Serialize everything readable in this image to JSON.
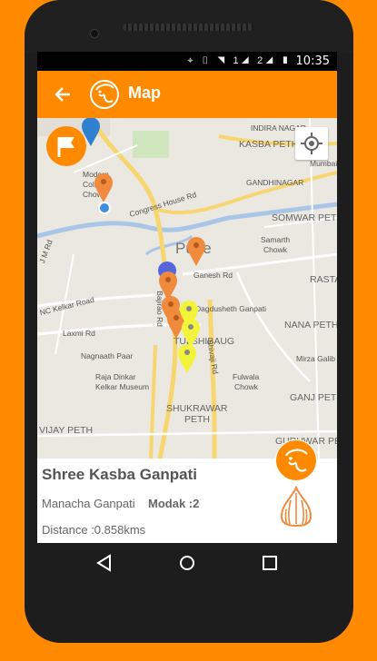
{
  "status": {
    "time": "10:35",
    "signal1": "1",
    "signal2": "2"
  },
  "appbar": {
    "title": "Map",
    "back_icon": "arrow-back-icon",
    "logo_icon": "ganpati-face-icon"
  },
  "map": {
    "labels": {
      "kasba_peth": "KASBA PETH",
      "indira": "INDIRA NAGAR",
      "gandhinagar": "GANDHINAGAR",
      "somwar": "SOMWAR PETH",
      "samarth": "Samarth",
      "chowk": "Chowk",
      "rasta": "RASTA",
      "nana": "NANA PETH",
      "mirza": "Mirza Galib",
      "ganj": "GANJ PETH",
      "guruwar": "GURUWAR PETH",
      "shukrawar": "SHUKRAWAR",
      "peth": "PETH",
      "fulwala": "Fulwala",
      "fchowk": "Chowk",
      "rajadinkar": "Raja Dinkar",
      "kelkar": "Kelkar Museum",
      "nagnaath": "Nagnaath Paar",
      "laxmi": "Laxmi Rd",
      "nckelkar": "NC Kelkar Road",
      "jmrd": "J M Rd",
      "congress": "Congress House Rd",
      "ganesh": "Ganesh Rd",
      "dagdusheth": "Dagdusheth Ganpati",
      "tulshibaug": "TULSHIBAUG",
      "bajirao": "Bajirao Rd",
      "shivaji": "Shivaji Rd",
      "pune": "Pune",
      "vijay": "VIJAY PETH",
      "mumbai": "Mumbai",
      "modern": "Modern",
      "coll": "Coll",
      "chowk2": "Chowk"
    }
  },
  "info": {
    "title": "Shree Kasba Ganpati",
    "mandal": "Manacha Ganpati",
    "modak": "Modak :2",
    "distance": "Distance :0.858kms"
  },
  "colors": {
    "accent": "#ff8a00",
    "pin_orange": "#f08a3c",
    "pin_yellow": "#f3f33a",
    "pin_blue": "#2f80d0"
  },
  "nav": {
    "back": "triangle-back-icon",
    "home": "circle-home-icon",
    "recents": "square-recents-icon"
  }
}
